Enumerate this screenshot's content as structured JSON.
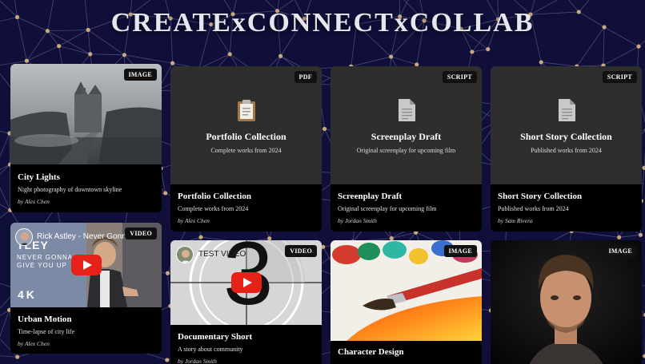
{
  "header": {
    "title": "CREATExCONNECTxCOLLAB"
  },
  "cards": [
    {
      "badge": "IMAGE",
      "title": "City Lights",
      "description": "Night photography of downtown skyline",
      "author": "by Alex Chen"
    },
    {
      "badge": "PDF",
      "thumb_title": "Portfolio Collection",
      "thumb_subtitle": "Complete works from 2024",
      "title": "Portfolio Collection",
      "description": "Complete works from 2024",
      "author": "by Alex Chen",
      "icon": "clipboard-icon"
    },
    {
      "badge": "SCRIPT",
      "thumb_title": "Screenplay Draft",
      "thumb_subtitle": "Original screenplay for upcoming film",
      "title": "Screenplay Draft",
      "description": "Original screenplay for upcoming film",
      "author": "by Jordan Smith",
      "icon": "document-icon"
    },
    {
      "badge": "SCRIPT",
      "thumb_title": "Short Story Collection",
      "thumb_subtitle": "Published works from 2024",
      "title": "Short Story Collection",
      "description": "Published works from 2024",
      "author": "by Sam Rivera",
      "icon": "document-icon"
    },
    {
      "badge": "VIDEO",
      "embed_title": "Rick Astley - Never Gonn...",
      "overlay_line1": "NEVER GONNA",
      "overlay_line2": "GIVE YOU UP",
      "overlay_quality": "4K",
      "overlay_name": "TLEY",
      "title": "Urban Motion",
      "description": "Time-lapse of city life",
      "author": "by Alex Chen"
    },
    {
      "badge": "VIDEO",
      "embed_title": "TEST VIDEO",
      "countdown": "3",
      "title": "Documentary Short",
      "description": "A story about community",
      "author": "by Jordan Smith"
    },
    {
      "badge": "IMAGE",
      "title": "Character Design"
    },
    {
      "badge": "IMAGE"
    }
  ],
  "colors": {
    "background": "#0f0f3a",
    "network_dots": "#c8a97e",
    "play_button": "#e62117",
    "card": "#000000",
    "doc_thumb": "#2e2e2e"
  }
}
